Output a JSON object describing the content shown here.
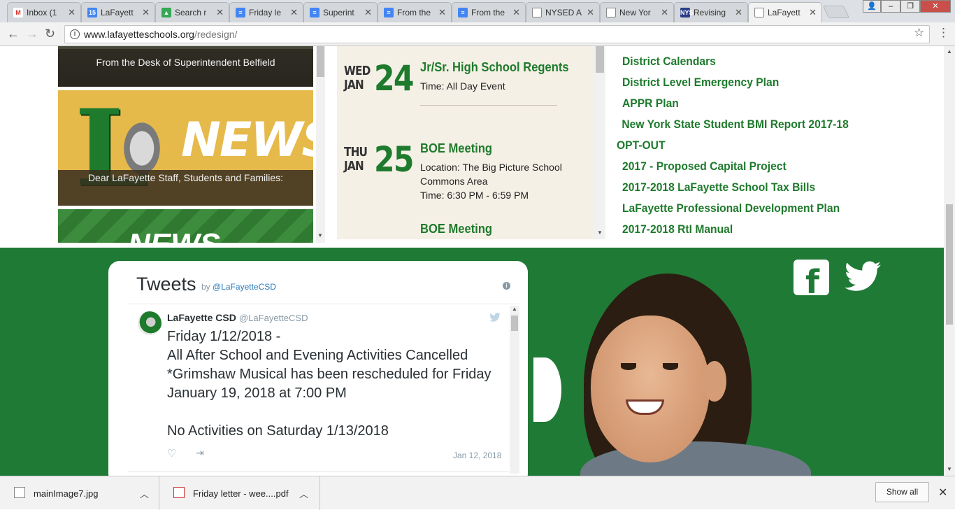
{
  "browser": {
    "tabs": [
      {
        "title": "Inbox (1",
        "favicon": "gmail-icon",
        "favicon_text": "M",
        "color": "#d93025"
      },
      {
        "title": "LaFayett",
        "favicon": "calendar-icon",
        "favicon_text": "15",
        "color": "#4285f4"
      },
      {
        "title": "Search r",
        "favicon": "drive-icon",
        "favicon_text": "▲",
        "color": "#34a853"
      },
      {
        "title": "Friday le",
        "favicon": "docs-icon",
        "favicon_text": "≡",
        "color": "#4285f4"
      },
      {
        "title": "Superint",
        "favicon": "docs-icon",
        "favicon_text": "≡",
        "color": "#4285f4"
      },
      {
        "title": "From the",
        "favicon": "docs-icon",
        "favicon_text": "≡",
        "color": "#4285f4"
      },
      {
        "title": "From the",
        "favicon": "docs-icon",
        "favicon_text": "≡",
        "color": "#4285f4"
      },
      {
        "title": "NYSED A",
        "favicon": "page-icon",
        "favicon_text": "",
        "color": "#ffffff"
      },
      {
        "title": "New Yor",
        "favicon": "page-icon",
        "favicon_text": "",
        "color": "#ffffff"
      },
      {
        "title": "Revising",
        "favicon": "nys-icon",
        "favicon_text": "NYS",
        "color": "#2a3e8a"
      },
      {
        "title": "LaFayett",
        "favicon": "page-icon",
        "favicon_text": "",
        "color": "#ffffff",
        "active": true
      }
    ],
    "url_host": "www.lafayetteschools.org",
    "url_path": "/redesign/"
  },
  "news": {
    "items": [
      {
        "caption": "From the Desk of Superintendent Belfield"
      },
      {
        "caption": "Dear LaFayette Staff, Students and Families:",
        "image_word": "NEWS",
        "image_letter": "L"
      },
      {
        "image_word": "NEWS"
      }
    ]
  },
  "events": [
    {
      "dow": "WED",
      "month": "JAN",
      "day": "24",
      "title": "Jr/Sr. High School Regents",
      "details": [
        "Time: All Day Event"
      ]
    },
    {
      "dow": "THU",
      "month": "JAN",
      "day": "25",
      "title": "BOE Meeting",
      "details": [
        "Location: The Big Picture School Commons Area",
        "Time: 6:30 PM - 6:59 PM"
      ]
    },
    {
      "title": "BOE Meeting"
    }
  ],
  "links": [
    "District Calendars",
    "District Level Emergency Plan",
    "APPR Plan",
    "New York State Student BMI Report 2017-18 OPT-OUT",
    "2017 - Proposed Capital Project",
    "2017-2018 LaFayette School Tax Bills",
    "LaFayette Professional Development Plan",
    "2017-2018 RtI Manual"
  ],
  "tweets_widget": {
    "title": "Tweets",
    "by_prefix": "by",
    "by_handle": "@LaFayetteCSD",
    "tweet": {
      "author": "LaFayette CSD",
      "handle": "@LaFayetteCSD",
      "text": "Friday 1/12/2018 -\nAll After School and Evening Activities Cancelled\n*Grimshaw Musical has been rescheduled for Friday January 19, 2018 at 7:00 PM\n\nNo Activities on Saturday 1/13/2018",
      "date": "Jan 12, 2018"
    }
  },
  "social": {
    "facebook": "facebook-icon",
    "twitter": "twitter-icon"
  },
  "downloads": {
    "items": [
      {
        "name": "mainImage7.jpg"
      },
      {
        "name": "Friday letter - wee....pdf"
      }
    ],
    "show_all": "Show all"
  },
  "colors": {
    "brand_green": "#1f7a35",
    "link_green": "#1e7a2c",
    "event_bg": "#f5f0e6"
  }
}
